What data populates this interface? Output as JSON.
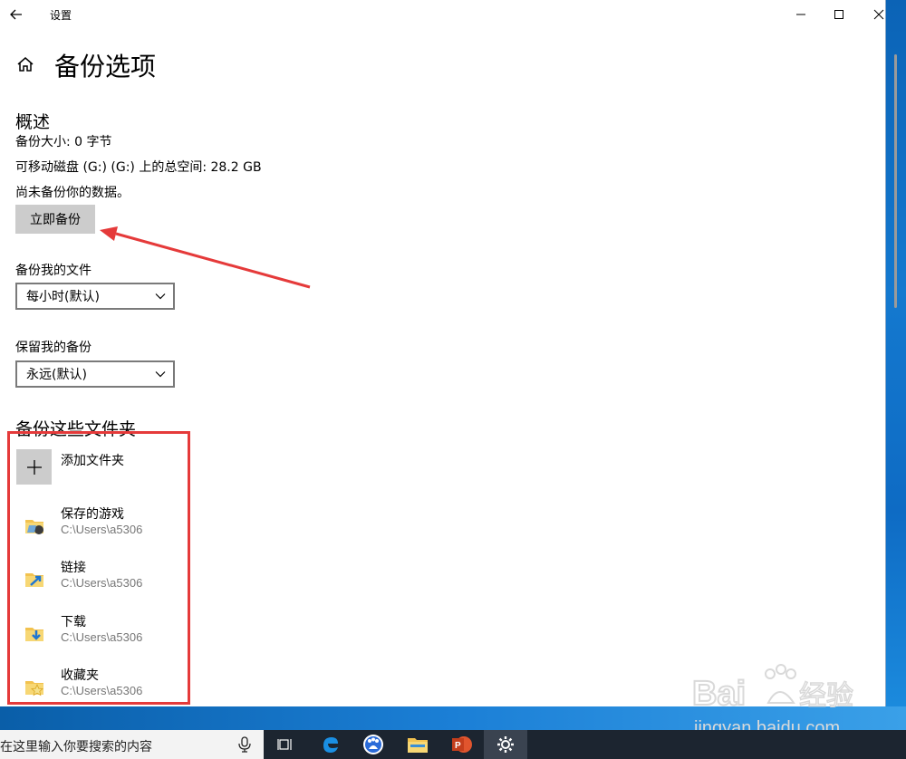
{
  "window": {
    "title": "设置"
  },
  "page": {
    "title": "备份选项"
  },
  "overview": {
    "heading": "概述",
    "size_line": "备份大小: 0 字节",
    "space_line": "可移动磁盘 (G:) (G:) 上的总空间: 28.2 GB",
    "status_line": "尚未备份你的数据。",
    "backup_now_label": "立即备份"
  },
  "frequency": {
    "label": "备份我的文件",
    "value": "每小时(默认)"
  },
  "retention": {
    "label": "保留我的备份",
    "value": "永远(默认)"
  },
  "folders": {
    "heading": "备份这些文件夹",
    "add_label": "添加文件夹",
    "items": [
      {
        "name": "保存的游戏",
        "path": "C:\\Users\\a5306",
        "icon": "saved-games-folder-icon"
      },
      {
        "name": "链接",
        "path": "C:\\Users\\a5306",
        "icon": "links-folder-icon"
      },
      {
        "name": "下载",
        "path": "C:\\Users\\a5306",
        "icon": "downloads-folder-icon"
      },
      {
        "name": "收藏夹",
        "path": "C:\\Users\\a5306",
        "icon": "favorites-folder-icon"
      }
    ]
  },
  "taskbar": {
    "search_placeholder": "在这里输入你要搜索的内容",
    "apps": [
      "task-view-icon",
      "edge-icon",
      "baidu-netdisk-icon",
      "file-explorer-icon",
      "powerpoint-icon",
      "settings-icon"
    ]
  },
  "watermark": {
    "brand": "Baidu",
    "brand_cn": "经验",
    "url": "jingyan.baidu.com"
  },
  "colors": {
    "annotation": "#e53a3a",
    "button_bg": "#cccccc",
    "secondary_text": "#767676",
    "taskbar": "#1c2530"
  }
}
